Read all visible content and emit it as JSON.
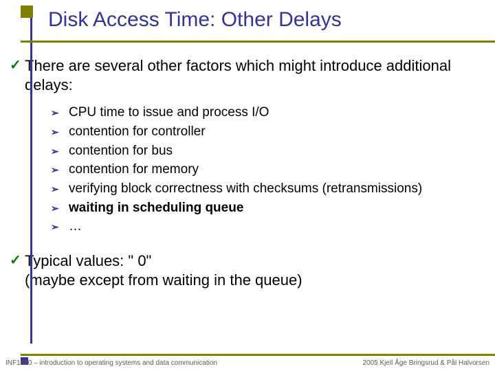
{
  "title": "Disk Access Time: Other Delays",
  "point1": "There are several other factors which might introduce additional delays:",
  "subs": {
    "s0": "CPU time to issue and process I/O",
    "s1": "contention for controller",
    "s2": "contention for bus",
    "s3": "contention for memory",
    "s4": "verifying block correctness with checksums (retransmissions)",
    "s5": "waiting in scheduling queue",
    "s6": "…"
  },
  "point2a": "Typical values: \" 0\"",
  "point2b": "(maybe except from waiting in the queue)",
  "footer": {
    "left": "INF1060 – introduction to operating systems and data communication",
    "right": "2005 Kjell Åge Bringsrud & Pål Halvorsen"
  }
}
